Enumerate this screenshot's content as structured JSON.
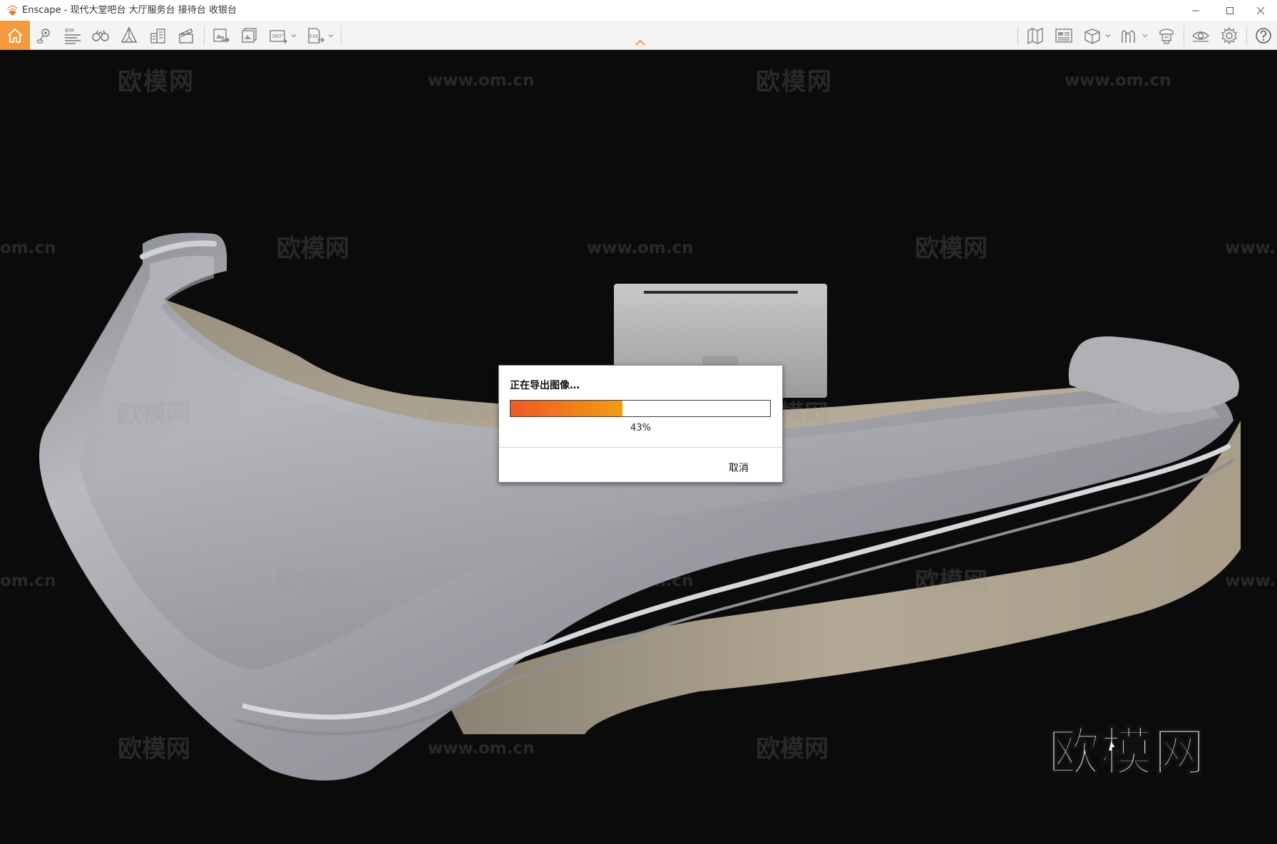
{
  "window": {
    "app_name": "Enscape",
    "title": "Enscape - 现代大堂吧台 大厅服务台 接待台 收银台",
    "brand_color": "#f29a3c"
  },
  "toolbar": {
    "left_groups": [
      [
        "home-icon",
        "location-pin-icon",
        "bim-icon",
        "binoculars-icon",
        "perspective-icon",
        "buildings-icon",
        "clapperboard-icon"
      ],
      [
        "screenshot-export-icon",
        "batch-render-icon",
        "panorama-360-icon",
        "exe-export-icon"
      ]
    ],
    "bim_label": "BIM",
    "pano_label": "360°",
    "exe_label": "EXE",
    "right_icons": [
      "map-icon",
      "asset-library-icon",
      "view-cube-icon",
      "material-editor-icon",
      "sync-icon",
      "visual-settings-icon",
      "settings-gear-icon",
      "help-icon"
    ]
  },
  "viewport": {
    "watermark_cn": "欧模网",
    "watermark_url": "www.om.cn",
    "watermark_url_partial_left": "om.cn",
    "watermark_url_partial_right": "www.",
    "logo_big": "欧模网"
  },
  "dialog": {
    "title": "正在导出图像…",
    "progress": 0.43,
    "progress_text": "43%",
    "cancel_label": "取消",
    "fill_start_color": "#ee5a24",
    "fill_end_color": "#f39c12"
  }
}
